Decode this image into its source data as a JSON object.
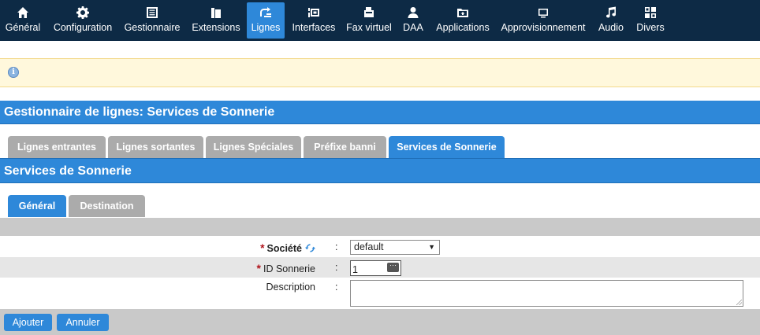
{
  "nav": {
    "items": [
      {
        "label": "Général",
        "icon": "home-icon"
      },
      {
        "label": "Configuration",
        "icon": "gear-icon"
      },
      {
        "label": "Gestionnaire",
        "icon": "list-icon"
      },
      {
        "label": "Extensions",
        "icon": "phone-icon"
      },
      {
        "label": "Lignes",
        "icon": "lines-icon"
      },
      {
        "label": "Interfaces",
        "icon": "interfaces-icon"
      },
      {
        "label": "Fax virtuel",
        "icon": "fax-icon"
      },
      {
        "label": "DAA",
        "icon": "user-icon"
      },
      {
        "label": "Applications",
        "icon": "applications-icon"
      },
      {
        "label": "Approvisionnement",
        "icon": "provisioning-icon"
      },
      {
        "label": "Audio",
        "icon": "music-icon"
      },
      {
        "label": "Divers",
        "icon": "misc-icon"
      }
    ],
    "active": "Lignes"
  },
  "page": {
    "title": "Gestionnaire de lignes:  Services de Sonnerie",
    "section_title": "Services de Sonnerie"
  },
  "tabs": {
    "primary": [
      "Lignes entrantes",
      "Lignes sortantes",
      "Lignes Spéciales",
      "Préfixe banni",
      "Services de Sonnerie"
    ],
    "primary_active": "Services de Sonnerie",
    "secondary": [
      "Général",
      "Destination"
    ],
    "secondary_active": "Général"
  },
  "form": {
    "societe_label": "Société",
    "societe_value": "default",
    "id_label": "ID Sonnerie",
    "id_value": "1",
    "description_label": "Description",
    "description_value": "",
    "colon": ":"
  },
  "buttons": {
    "add": "Ajouter",
    "cancel": "Annuler"
  },
  "colors": {
    "nav_bg": "#0d2a45",
    "accent": "#2e88d9",
    "tab_inactive": "#ababab",
    "required": "#b0151d",
    "info_bg": "#fff8dc"
  }
}
